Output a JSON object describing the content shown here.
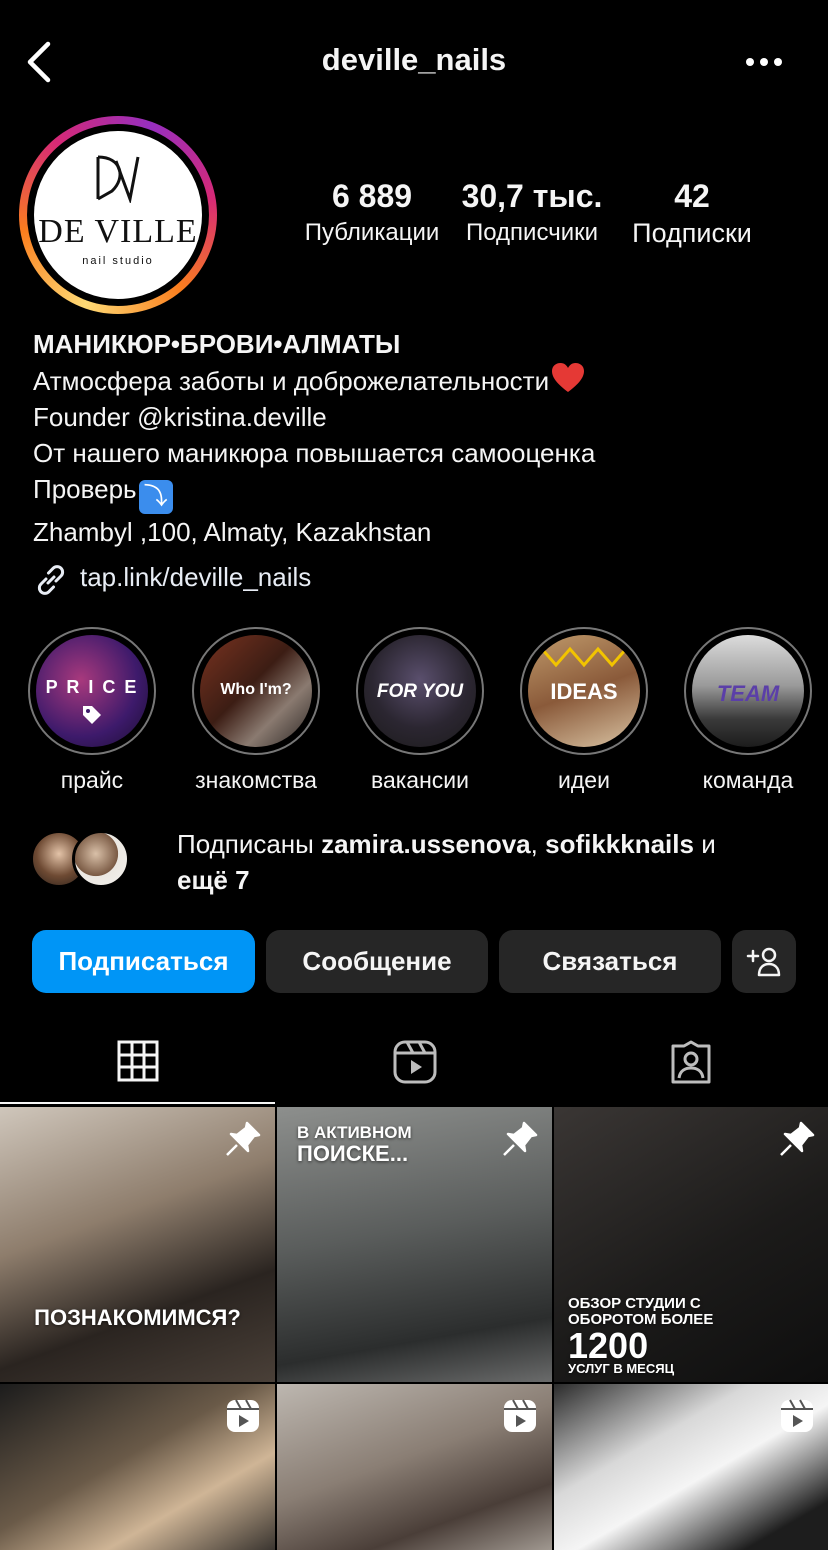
{
  "header": {
    "username": "deville_nails"
  },
  "avatar": {
    "logo_word": "DE VILLE",
    "logo_sub": "nail studio"
  },
  "stats": [
    {
      "value": "6 889",
      "label": "Публикации"
    },
    {
      "value": "30,7 тыс.",
      "label": "Подписчики"
    },
    {
      "value": "42",
      "label": "Подписки"
    }
  ],
  "bio": {
    "title": "МАНИКЮР•БРОВИ•АЛМАТЫ",
    "line1": "Атмосфера заботы и доброжелательности",
    "line2": "Founder @kristina.deville",
    "line3": "От нашего маникюра повышается самооценка",
    "line4": "Проверь",
    "line5": "Zhambyl ,100, Almaty, Kazakhstan"
  },
  "link": {
    "text": "tap.link/deville_nails"
  },
  "highlights": [
    {
      "label": "прайс",
      "cover_text": "P R I C E"
    },
    {
      "label": "знакомства",
      "cover_text": "Who I'm?"
    },
    {
      "label": "вакансии",
      "cover_text": "FOR YOU"
    },
    {
      "label": "идеи",
      "cover_text": "IDEAS"
    },
    {
      "label": "команда",
      "cover_text": "TEAM"
    }
  ],
  "followed_by": {
    "prefix": "Подписаны ",
    "user1": "zamira.ussenova",
    "sep": ", ",
    "user2": "sofikkknails",
    "suffix": " и",
    "more": "ещё 7"
  },
  "actions": {
    "follow": "Подписаться",
    "message": "Сообщение",
    "contact": "Связаться"
  },
  "posts": [
    {
      "caption": "ПОЗНАКОМИМСЯ?",
      "badge": "pin-icon"
    },
    {
      "caption_top": "В АКТИВНОМ",
      "caption_bottom": "ПОИСКЕ...",
      "badge": "pin-icon"
    },
    {
      "caption_top": "ОБЗОР СТУДИИ С",
      "caption_mid": "ОБОРОТОМ БОЛЕЕ",
      "caption_big": "1200",
      "caption_small": "УСЛУГ В МЕСЯЦ",
      "badge": "pin-icon"
    },
    {
      "badge": "reels-icon"
    },
    {
      "badge": "reels-icon"
    },
    {
      "badge": "reels-icon"
    }
  ],
  "colors": {
    "follow_button": "#0095f6",
    "secondary_button": "#262626",
    "background": "#000000"
  }
}
